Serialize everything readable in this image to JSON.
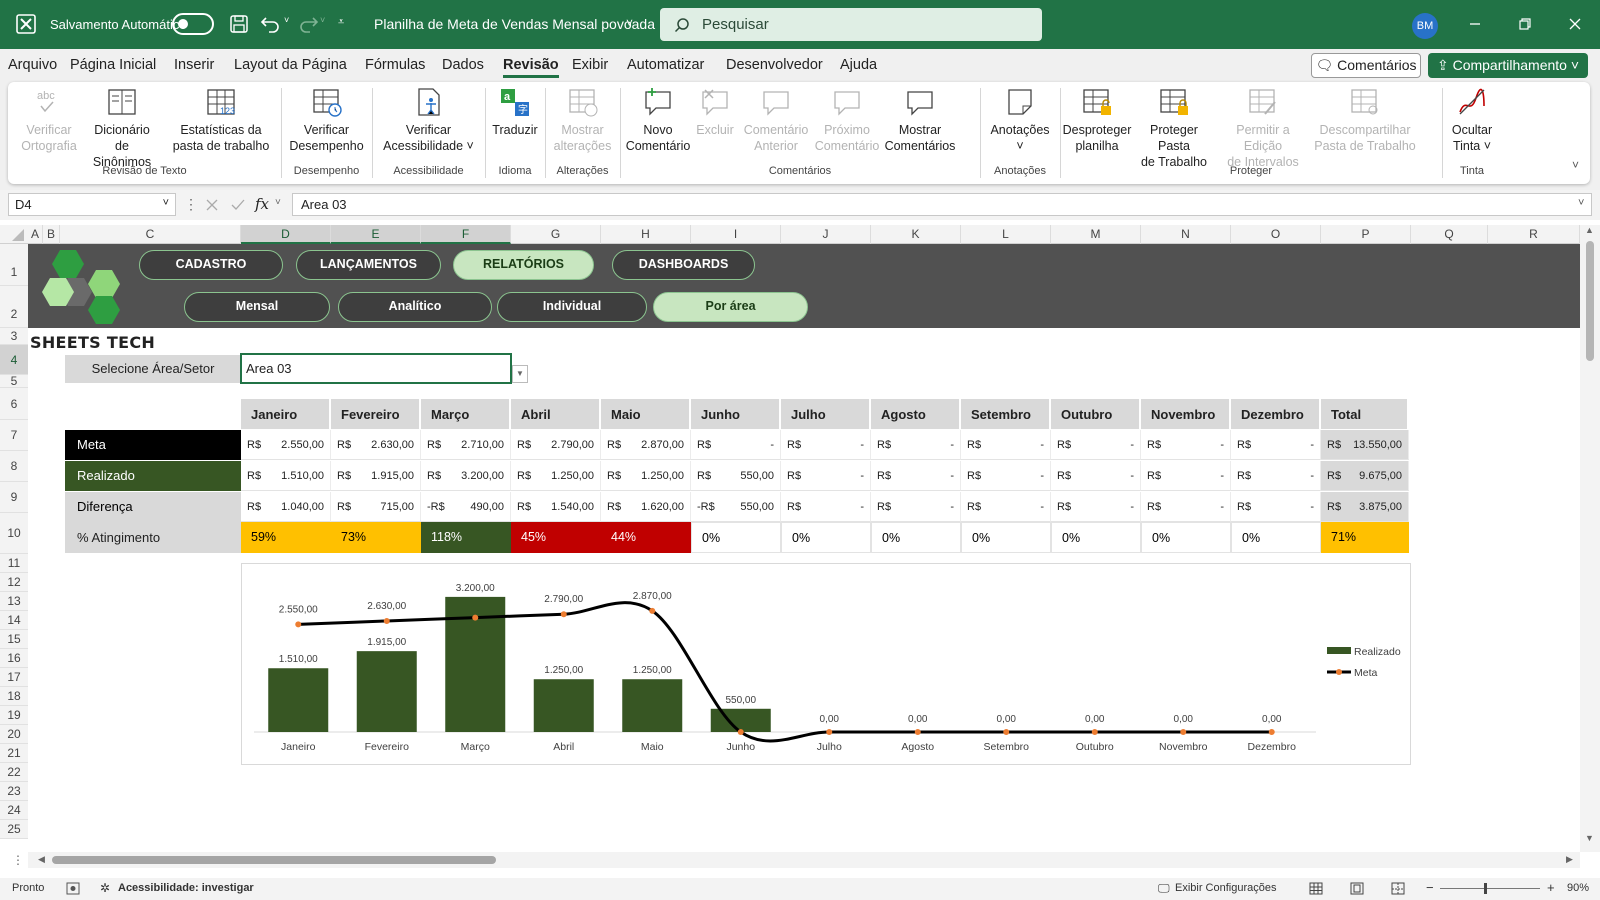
{
  "titlebar": {
    "autosave_label": "Salvamento Automático",
    "file_name": "Planilha de Meta de Vendas Mensal povoada",
    "search_placeholder": "Pesquisar",
    "user_initials": "BM"
  },
  "menu": {
    "items": [
      "Arquivo",
      "Página Inicial",
      "Inserir",
      "Layout da Página",
      "Fórmulas",
      "Dados",
      "Revisão",
      "Exibir",
      "Automatizar",
      "Desenvolvedor",
      "Ajuda"
    ],
    "active": "Revisão",
    "comments_label": "Comentários",
    "share_label": "Compartilhamento"
  },
  "ribbon": {
    "buttons": [
      {
        "l1": "Verificar",
        "l2": "Ortografia",
        "disabled": true,
        "icon": "spell-check-icon"
      },
      {
        "l1": "Dicionário",
        "l2": "de Sinônimos",
        "disabled": false,
        "icon": "thesaurus-icon"
      },
      {
        "l1": "Estatísticas da",
        "l2": "pasta de trabalho",
        "disabled": false,
        "icon": "workbook-stats-icon"
      },
      {
        "l1": "Verificar",
        "l2": "Desempenho",
        "disabled": false,
        "icon": "performance-icon"
      },
      {
        "l1": "Verificar",
        "l2": "Acessibilidade ˅",
        "disabled": false,
        "icon": "accessibility-icon"
      },
      {
        "l1": "Traduzir",
        "l2": "",
        "disabled": false,
        "icon": "translate-icon"
      },
      {
        "l1": "Mostrar",
        "l2": "alterações",
        "disabled": true,
        "icon": "show-changes-icon"
      },
      {
        "l1": "Novo",
        "l2": "Comentário",
        "disabled": false,
        "icon": "new-comment-icon"
      },
      {
        "l1": "Excluir",
        "l2": "",
        "disabled": true,
        "icon": "delete-comment-icon"
      },
      {
        "l1": "Comentário",
        "l2": "Anterior",
        "disabled": true,
        "icon": "previous-comment-icon"
      },
      {
        "l1": "Próximo",
        "l2": "Comentário",
        "disabled": true,
        "icon": "next-comment-icon"
      },
      {
        "l1": "Mostrar",
        "l2": "Comentários",
        "disabled": false,
        "icon": "show-comments-icon"
      },
      {
        "l1": "Anotações",
        "l2": "˅",
        "disabled": false,
        "icon": "notes-icon"
      },
      {
        "l1": "Desproteger",
        "l2": "planilha",
        "disabled": false,
        "icon": "unprotect-sheet-icon"
      },
      {
        "l1": "Proteger Pasta",
        "l2": "de Trabalho",
        "disabled": false,
        "icon": "protect-workbook-icon"
      },
      {
        "l1": "Permitir a Edição",
        "l2": "de Intervalos",
        "disabled": true,
        "icon": "allow-edit-ranges-icon"
      },
      {
        "l1": "Descompartilhar",
        "l2": "Pasta de Trabalho",
        "disabled": true,
        "icon": "unshare-workbook-icon"
      },
      {
        "l1": "Ocultar",
        "l2": "Tinta ˅",
        "disabled": false,
        "icon": "hide-ink-icon"
      }
    ],
    "groups": [
      "Revisão de Texto",
      "Desempenho",
      "Acessibilidade",
      "Idioma",
      "Alterações",
      "Comentários",
      "Anotações",
      "Proteger",
      "Tinta"
    ]
  },
  "formula_bar": {
    "cell_ref": "D4",
    "fx": "fx",
    "content": "Area 03"
  },
  "columns": [
    "A",
    "B",
    "C",
    "D",
    "E",
    "F",
    "G",
    "H",
    "I",
    "J",
    "K",
    "L",
    "M",
    "N",
    "O",
    "P",
    "Q",
    "R"
  ],
  "rows": [
    "1",
    "2",
    "3",
    "4",
    "5",
    "6",
    "7",
    "8",
    "9",
    "10",
    "11",
    "12",
    "13",
    "14",
    "15",
    "16",
    "17",
    "18",
    "19",
    "20",
    "21",
    "22",
    "23",
    "24",
    "25"
  ],
  "nav": {
    "top": [
      "CADASTRO",
      "LANÇAMENTOS",
      "RELATÓRIOS",
      "DASHBOARDS"
    ],
    "top_active": "RELATÓRIOS",
    "sub": [
      "Mensal",
      "Analítico",
      "Individual",
      "Por área"
    ],
    "sub_active": "Por área"
  },
  "brand": "SHEETS TECH",
  "selector": {
    "label": "Selecione Área/Setor",
    "value": "Area 03"
  },
  "table": {
    "headers": [
      "Janeiro",
      "Fevereiro",
      "Março",
      "Abril",
      "Maio",
      "Junho",
      "Julho",
      "Agosto",
      "Setembro",
      "Outubro",
      "Novembro",
      "Dezembro",
      "Total"
    ],
    "currency": "R$",
    "rows": [
      {
        "label": "Meta",
        "bg": "#000000",
        "fg": "#ffffff",
        "cells": [
          [
            "R$",
            "2.550,00"
          ],
          [
            "R$",
            "2.630,00"
          ],
          [
            "R$",
            "2.710,00"
          ],
          [
            "R$",
            "2.790,00"
          ],
          [
            "R$",
            "2.870,00"
          ],
          [
            "R$",
            "-"
          ],
          [
            "R$",
            "-"
          ],
          [
            "R$",
            "-"
          ],
          [
            "R$",
            "-"
          ],
          [
            "R$",
            "-"
          ],
          [
            "R$",
            "-"
          ],
          [
            "R$",
            "-"
          ],
          [
            "R$",
            "13.550,00"
          ]
        ]
      },
      {
        "label": "Realizado",
        "bg": "#375623",
        "fg": "#ffffff",
        "cells": [
          [
            "R$",
            "1.510,00"
          ],
          [
            "R$",
            "1.915,00"
          ],
          [
            "R$",
            "3.200,00"
          ],
          [
            "R$",
            "1.250,00"
          ],
          [
            "R$",
            "1.250,00"
          ],
          [
            "R$",
            "550,00"
          ],
          [
            "R$",
            "-"
          ],
          [
            "R$",
            "-"
          ],
          [
            "R$",
            "-"
          ],
          [
            "R$",
            "-"
          ],
          [
            "R$",
            "-"
          ],
          [
            "R$",
            "-"
          ],
          [
            "R$",
            "9.675,00"
          ]
        ]
      },
      {
        "label": "Diferença",
        "bg": "#d9d9d9",
        "fg": "#000000",
        "cells": [
          [
            "R$",
            "1.040,00"
          ],
          [
            "R$",
            "715,00"
          ],
          [
            "-R$",
            "490,00"
          ],
          [
            "R$",
            "1.540,00"
          ],
          [
            "R$",
            "1.620,00"
          ],
          [
            "-R$",
            "550,00"
          ],
          [
            "R$",
            "-"
          ],
          [
            "R$",
            "-"
          ],
          [
            "R$",
            "-"
          ],
          [
            "R$",
            "-"
          ],
          [
            "R$",
            "-"
          ],
          [
            "R$",
            "-"
          ],
          [
            "R$",
            "3.875,00"
          ]
        ]
      }
    ],
    "pct_row": {
      "label": "% Atingimento",
      "values": [
        "59%",
        "73%",
        "118%",
        "45%",
        "44%",
        "0%",
        "0%",
        "0%",
        "0%",
        "0%",
        "0%",
        "0%",
        "71%"
      ],
      "colors": [
        "#ffc000",
        "#ffc000",
        "#375623",
        "#c00000",
        "#c00000",
        "#ffffff",
        "#ffffff",
        "#ffffff",
        "#ffffff",
        "#ffffff",
        "#ffffff",
        "#ffffff",
        "#ffc000"
      ]
    }
  },
  "chart_data": {
    "type": "bar",
    "categories": [
      "Janeiro",
      "Fevereiro",
      "Março",
      "Abril",
      "Maio",
      "Junho",
      "Julho",
      "Agosto",
      "Setembro",
      "Outubro",
      "Novembro",
      "Dezembro"
    ],
    "series": [
      {
        "name": "Realizado",
        "kind": "bar",
        "color": "#375623",
        "values": [
          1510,
          1915,
          3200,
          1250,
          1250,
          550,
          0,
          0,
          0,
          0,
          0,
          0
        ],
        "labels": [
          "1.510,00",
          "1.915,00",
          "3.200,00",
          "1.250,00",
          "1.250,00",
          "550,00",
          "0,00",
          "0,00",
          "0,00",
          "0,00",
          "0,00",
          "0,00"
        ]
      },
      {
        "name": "Meta",
        "kind": "line",
        "color": "#000000",
        "marker_color": "#ed7d31",
        "values": [
          2550,
          2630,
          2710,
          2790,
          2870,
          0,
          0,
          0,
          0,
          0,
          0,
          0
        ],
        "labels": [
          "2.550,00",
          "2.630,00",
          "",
          "2.790,00",
          "2.870,00",
          "",
          "",
          "",
          "",
          "",
          "",
          ""
        ]
      }
    ],
    "ylim": [
      0,
      3600
    ],
    "legend_position": "right",
    "grid": false
  },
  "status": {
    "ready": "Pronto",
    "accessibility": "Acessibilidade: investigar",
    "display_settings": "Exibir Configurações",
    "zoom": "90%"
  }
}
